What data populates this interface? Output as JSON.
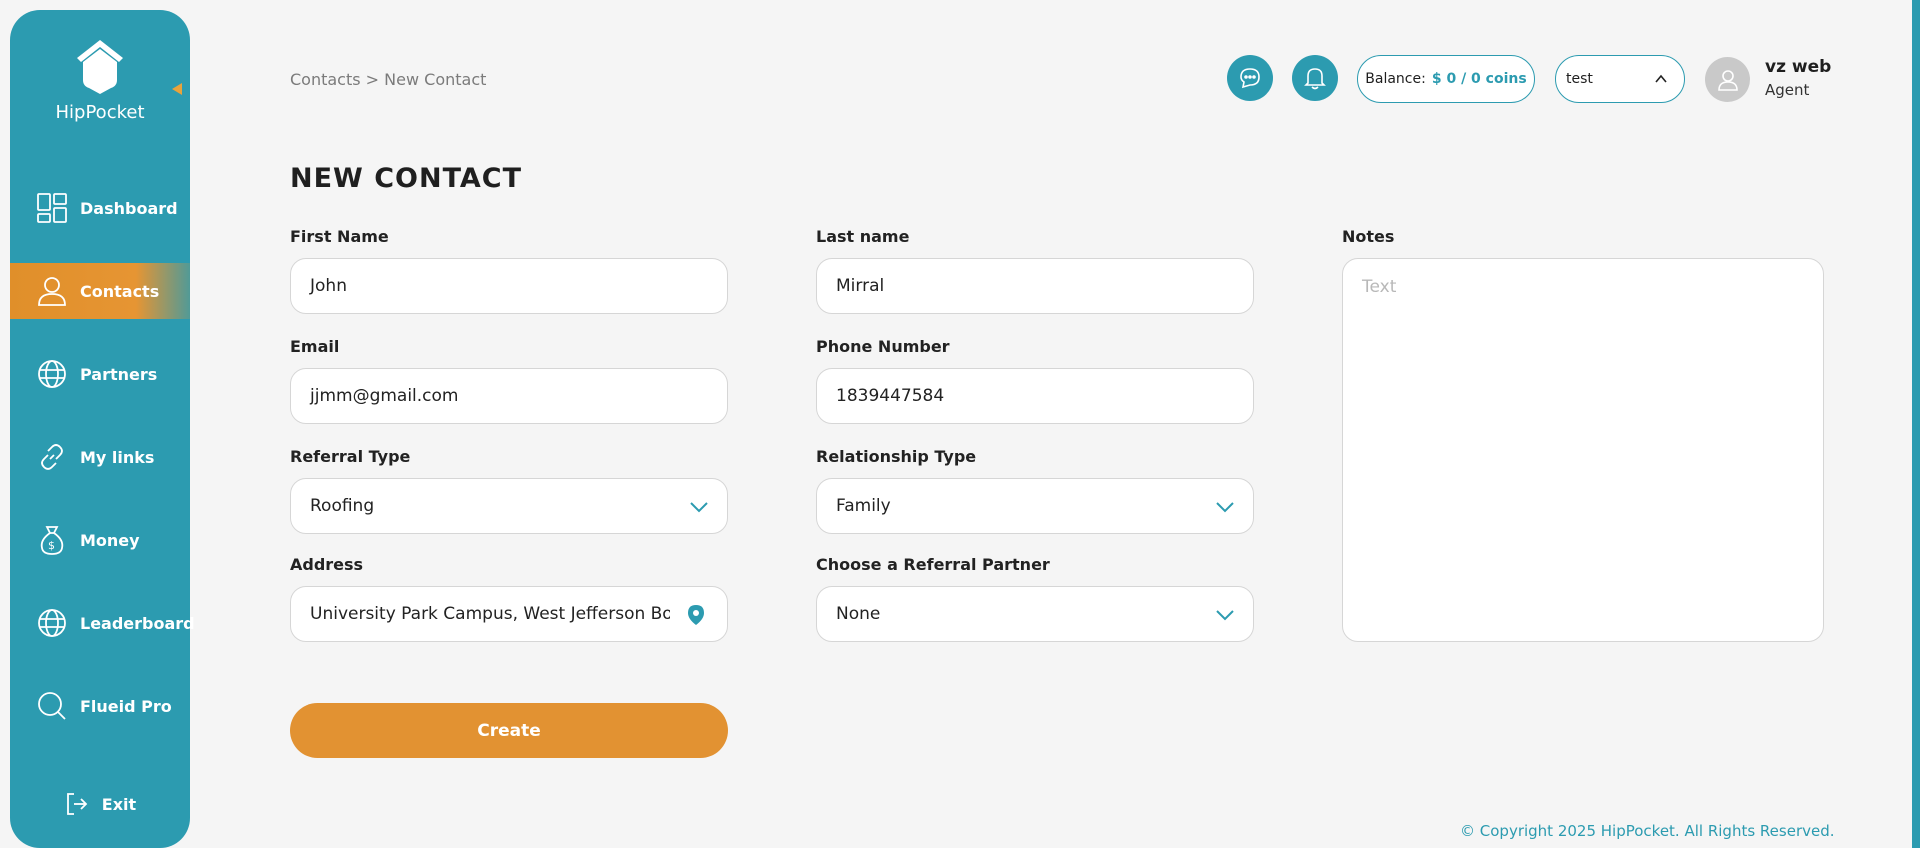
{
  "brand": {
    "name": "HipPocket"
  },
  "colors": {
    "primary": "#2c9bb0",
    "accent": "#e29232",
    "background": "#f5f5f5"
  },
  "sidebar": {
    "items": [
      {
        "label": "Dashboard",
        "icon": "dashboard-icon"
      },
      {
        "label": "Contacts",
        "icon": "person-icon",
        "active": true
      },
      {
        "label": "Partners",
        "icon": "globe-icon"
      },
      {
        "label": "My links",
        "icon": "link-icon"
      },
      {
        "label": "Money",
        "icon": "money-bag-icon"
      },
      {
        "label": "Leaderboard",
        "icon": "globe-icon"
      },
      {
        "label": "Flueid Pro",
        "icon": "search-icon"
      }
    ],
    "exit_label": "Exit"
  },
  "header": {
    "breadcrumb": "Contacts > New Contact",
    "balance_label": "Balance:",
    "balance_value": "$ 0 / 0 coins",
    "select_value": "test",
    "user_name": "vz web",
    "user_role": "Agent"
  },
  "form": {
    "title": "NEW CONTACT",
    "first_name": {
      "label": "First Name",
      "value": "John"
    },
    "last_name": {
      "label": "Last name",
      "value": "Mirral"
    },
    "notes": {
      "label": "Notes",
      "placeholder": "Text"
    },
    "email": {
      "label": "Email",
      "value": "jjmm@gmail.com"
    },
    "phone": {
      "label": "Phone Number",
      "value": "1839447584"
    },
    "referral_type": {
      "label": "Referral Type",
      "value": "Roofing"
    },
    "relationship_type": {
      "label": "Relationship Type",
      "value": "Family"
    },
    "address": {
      "label": "Address",
      "value": "University Park Campus, West Jefferson Boulev"
    },
    "referral_partner": {
      "label": "Choose a Referral Partner",
      "value": "None"
    },
    "create_label": "Create"
  },
  "footer": {
    "copyright": "© Copyright 2025 HipPocket. All Rights Reserved."
  }
}
